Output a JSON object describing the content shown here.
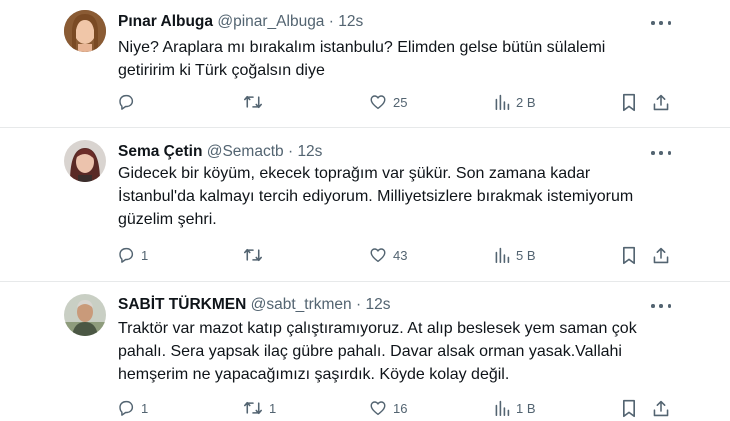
{
  "tweets": [
    {
      "name": "Pınar Albuga",
      "handle": "@pinar_Albuga",
      "sep": "·",
      "time": "12s",
      "lines": [
        "Niye? Araplara mı bırakalım istanbulu? Elimden gelse bütün sülalemi",
        "getiririm ki Türk çoğalsın diye"
      ],
      "replies": "",
      "retweets": "",
      "likes": "25",
      "views": "2 B"
    },
    {
      "name": "Sema Çetin",
      "handle": "@Semactb",
      "sep": "·",
      "time": "12s",
      "lines": [
        "Gidecek bir köyüm, ekecek toprağım var şükür. Son zamana kadar",
        "İstanbul'da kalmayı tercih ediyorum. Milliyetsizlere bırakmak istemiyorum",
        "güzelim şehri."
      ],
      "replies": "1",
      "retweets": "",
      "likes": "43",
      "views": "5 B"
    },
    {
      "name": "SABİT TÜRKMEN",
      "handle": "@sabt_trkmen",
      "sep": "·",
      "time": "12s",
      "lines": [
        "Traktör var mazot katıp çalıştıramıyoruz. At alıp beslesek yem saman çok",
        "pahalı. Sera yapsak ilaç gübre pahalı. Davar alsak orman yasak.Vallahi",
        "hemşerim ne yapacağımızı şaşırdık. Köyde kolay değil."
      ],
      "replies": "1",
      "retweets": "1",
      "likes": "16",
      "views": "1 B"
    }
  ],
  "icons": {
    "reply": "reply-icon",
    "retweet": "retweet-icon",
    "like": "heart-icon",
    "views": "analytics-icon",
    "bookmark": "bookmark-icon",
    "share": "share-icon",
    "more": "more-icon"
  },
  "colors": {
    "text": "#0f1419",
    "muted": "#536471",
    "divider": "#e7e9ea"
  }
}
